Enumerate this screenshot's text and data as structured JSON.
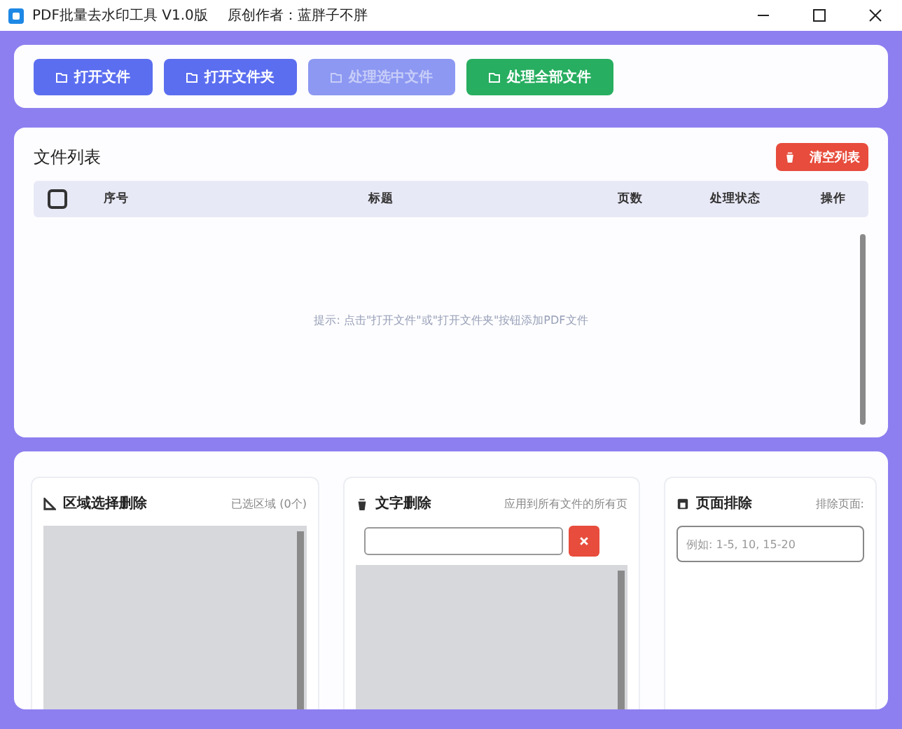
{
  "window": {
    "title": "PDF批量去水印工具 V1.0版",
    "author": "原创作者：蓝胖子不胖"
  },
  "toolbar": [
    {
      "label": "打开文件",
      "kind": "primary",
      "disabled": false
    },
    {
      "label": "打开文件夹",
      "kind": "primary",
      "disabled": false
    },
    {
      "label": "处理选中文件",
      "kind": "primary",
      "disabled": true
    },
    {
      "label": "处理全部文件",
      "kind": "success",
      "disabled": false
    }
  ],
  "file_list": {
    "title": "文件列表",
    "clear_button": "清空列表",
    "select_all_checked": false,
    "columns": [
      "序号",
      "标题",
      "页数",
      "处理状态",
      "操作"
    ],
    "empty_hint": "提示: 点击\"打开文件\"或\"打开文件夹\"按钮添加PDF文件"
  },
  "panels": [
    {
      "kind": "region",
      "title": "区域选择删除",
      "note": "已选区域 (0个)"
    },
    {
      "kind": "text",
      "title": "文字删除",
      "note": "应用到所有文件的所有页"
    },
    {
      "kind": "pages",
      "title": "页面排除",
      "note": "排除页面:",
      "placeholder": "例如: 1-5, 10, 15-20"
    }
  ]
}
